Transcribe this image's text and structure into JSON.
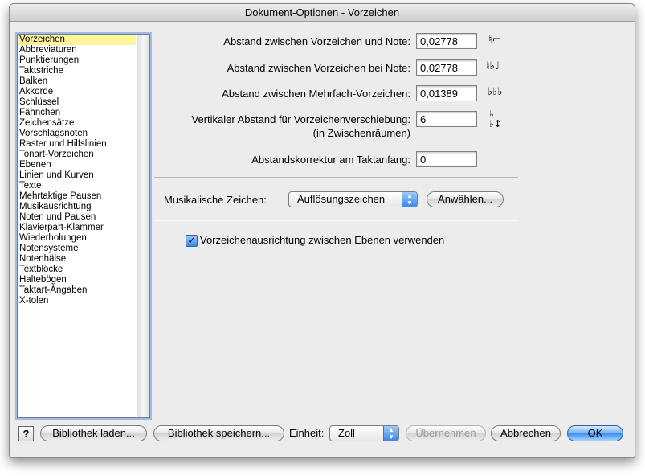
{
  "window": {
    "title": "Dokument-Optionen - Vorzeichen"
  },
  "sidebar": {
    "selected_index": 0,
    "items": [
      "Vorzeichen",
      "Abbreviaturen",
      "Punktierungen",
      "Taktstriche",
      "Balken",
      "Akkorde",
      "Schlüssel",
      "Fähnchen",
      "Zeichensätze",
      "Vorschlagsnoten",
      "Raster und Hilfslinien",
      "Tonart-Vorzeichen",
      "Ebenen",
      "Linien und Kurven",
      "Texte",
      "Mehrtaktige Pausen",
      "Musikausrichtung",
      "Noten und Pausen",
      "Klavierpart-Klammer",
      "Wiederholungen",
      "Notensysteme",
      "Notenhälse",
      "Textblöcke",
      "Haltebögen",
      "Taktart-Angaben",
      "X-tolen"
    ]
  },
  "settings": {
    "spacing_note_label": "Abstand zwischen Vorzeichen und Note:",
    "spacing_note_value": "0,02778",
    "spacing_at_note_label": "Abstand zwischen Vorzeichen bei Note:",
    "spacing_at_note_value": "0,02778",
    "spacing_multi_label": "Abstand zwischen Mehrfach-Vorzeichen:",
    "spacing_multi_value": "0,01389",
    "vertical_shift_label": "Vertikaler Abstand für Vorzeichenverschiebung:",
    "vertical_shift_sublabel": "(in Zwischenräumen)",
    "vertical_shift_value": "6",
    "measure_start_label": "Abstandskorrektur am Taktanfang:",
    "measure_start_value": "0",
    "symbols_label": "Musikalische Zeichen:",
    "symbols_value": "Auflösungszeichen",
    "select_button": "Anwählen...",
    "align_checkbox_label": "Vorzeichenausrichtung zwischen Ebenen verwenden",
    "align_checkbox_checked": true
  },
  "footer": {
    "help": "?",
    "load_library": "Bibliothek laden...",
    "save_library": "Bibliothek speichern...",
    "unit_label": "Einheit:",
    "unit_value": "Zoll",
    "apply": "Übernehmen",
    "cancel": "Abbrechen",
    "ok": "OK"
  },
  "icons": {
    "accent_blue": "#3b86ea",
    "selection_yellow": "#fff59a"
  }
}
